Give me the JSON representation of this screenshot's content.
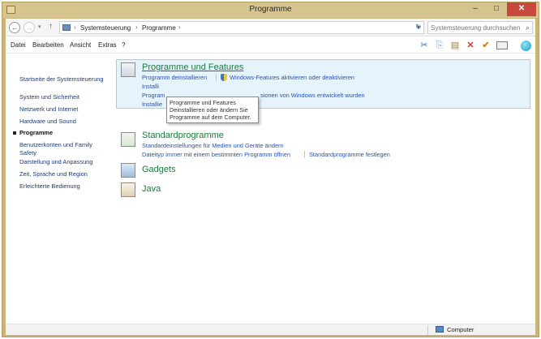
{
  "window": {
    "title": "Programme",
    "minimize": "–",
    "maximize": "□",
    "close": "✕"
  },
  "address": {
    "back": "←",
    "forward": "→",
    "dropdown": "▾",
    "up": "↑",
    "breadcrumb": [
      "Systemsteuerung",
      "Programme"
    ],
    "separator": "›",
    "refresh": "↻",
    "search_placeholder": "Systemsteuerung durchsuchen",
    "search_icon": "⌕"
  },
  "menu": {
    "items": [
      "Datei",
      "Bearbeiten",
      "Ansicht",
      "Extras",
      "?"
    ],
    "toolbar_glyphs": {
      "cut": "✂",
      "copy": "⎘",
      "paste": "▤",
      "delete": "✕",
      "check": "✔"
    }
  },
  "sidebar": {
    "home": "Startseite der Systemsteuerung",
    "items": [
      "System und Sicherheit",
      "Netzwerk und Internet",
      "Hardware und Sound",
      "Programme",
      "Benutzerkonten und Family Safety",
      "Darstellung und Anpassung",
      "Zeit, Sprache und Region",
      "Erleichterte Bedienung"
    ]
  },
  "categories": {
    "programs": {
      "title": "Programme und Features",
      "links": [
        "Programm deinstallieren",
        "Windows-Features aktivieren oder deaktivieren",
        "Installi",
        "Program",
        "sionen von Windows entwickelt wurden",
        "Installie"
      ]
    },
    "defaults": {
      "title": "Standardprogramme",
      "links": [
        "Standardeinstellungen für Medien und Geräte ändern",
        "Dateityp immer mit einem bestimmten Programm öffnen",
        "Standardprogramme festlegen"
      ]
    },
    "gadgets": {
      "title": "Gadgets"
    },
    "java": {
      "title": "Java"
    }
  },
  "tooltip": {
    "lines": [
      "Programme und Features",
      "Deinstallieren oder ändern Sie",
      "Programme auf dem Computer."
    ]
  },
  "status": {
    "location": "Computer"
  },
  "colors": {
    "title_bar": "#d6c48f",
    "link": "#2a53b1",
    "category_title": "#1f7a3e",
    "highlight": "#e5f3fb",
    "close_button": "#c7483c"
  }
}
